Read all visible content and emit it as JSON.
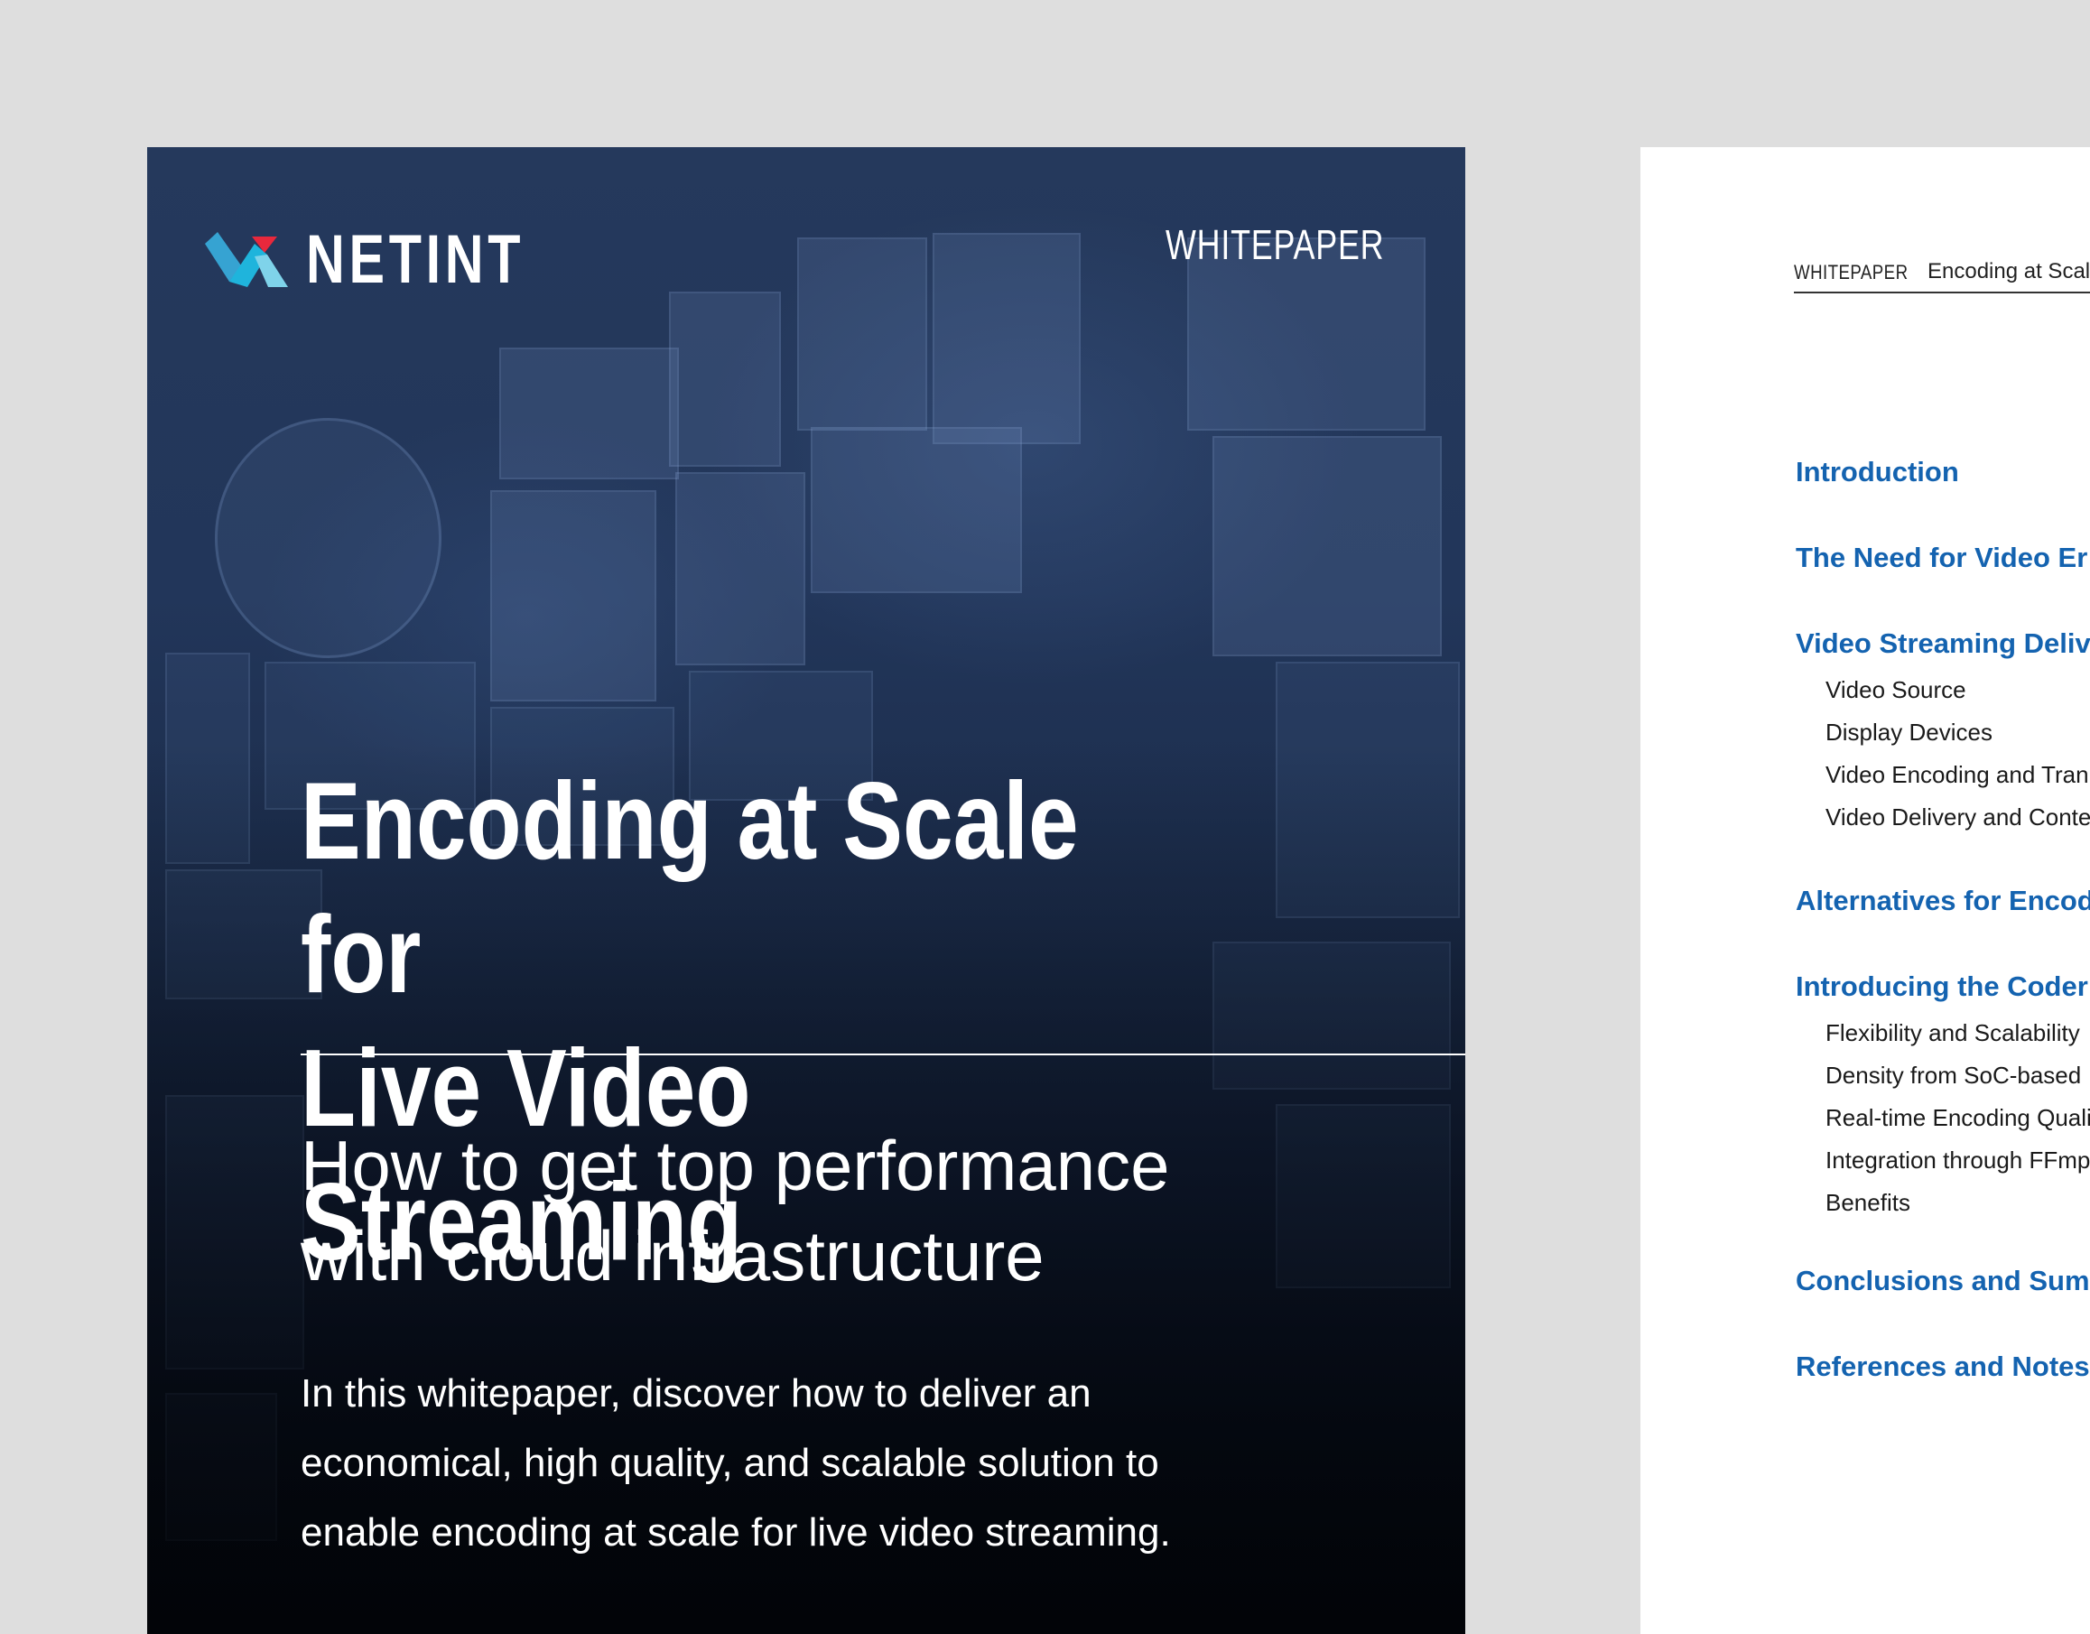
{
  "cover": {
    "logo_text": "NETINT",
    "label": "WHITEPAPER",
    "title_line1": "Encoding at Scale for",
    "title_line2": "Live Video Streaming",
    "subtitle_line1": "How to get top performance",
    "subtitle_line2": "with cloud infrastructure",
    "description_line1": "In this whitepaper, discover how to deliver an",
    "description_line2": "economical, high quality, and scalable solution to",
    "description_line3": "enable encoding at scale for live video streaming."
  },
  "toc_page": {
    "header_label": "WHITEPAPER",
    "header_title": "Encoding at Scal",
    "items": [
      {
        "text": "Introduction",
        "level": "section"
      },
      {
        "text": "The Need for Video Er",
        "level": "section"
      },
      {
        "text": "Video Streaming Deliv",
        "level": "section"
      },
      {
        "text": "Video Source",
        "level": "sub"
      },
      {
        "text": "Display Devices",
        "level": "sub"
      },
      {
        "text": "Video Encoding and Tran",
        "level": "sub"
      },
      {
        "text": "Video Delivery and Conte",
        "level": "sub"
      },
      {
        "text": "Alternatives for Encod",
        "level": "section"
      },
      {
        "text": "Introducing the Coder",
        "level": "section"
      },
      {
        "text": "Flexibility and Scalability",
        "level": "sub"
      },
      {
        "text": "Density from SoC-based",
        "level": "sub"
      },
      {
        "text": "Real-time Encoding Quali",
        "level": "sub"
      },
      {
        "text": "Integration through FFmp",
        "level": "sub"
      },
      {
        "text": "Benefits",
        "level": "sub"
      },
      {
        "text": "Conclusions and Sum",
        "level": "section"
      },
      {
        "text": "References and Notes",
        "level": "section"
      }
    ]
  },
  "colors": {
    "page_background": "#dedede",
    "toc_section_color": "#1463b0",
    "logo_cyan": "#1fb4dc",
    "logo_red": "#e8283c"
  }
}
